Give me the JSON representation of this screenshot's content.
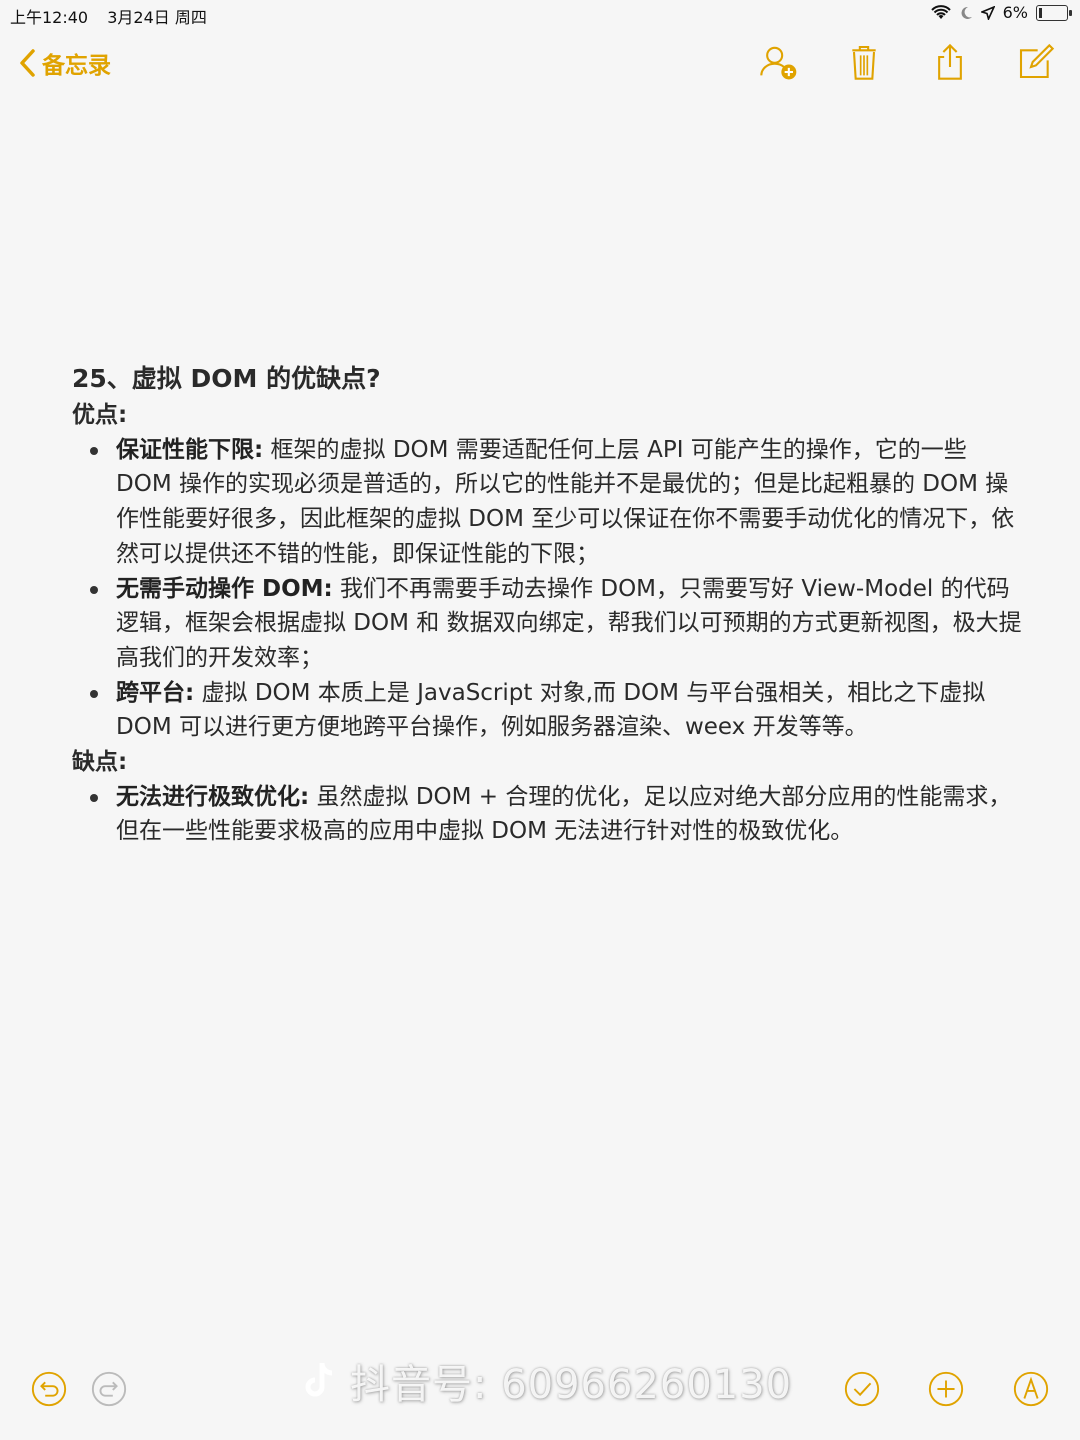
{
  "status_bar": {
    "time": "上午12:40",
    "date": "3月24日 周四",
    "battery": "6%"
  },
  "nav": {
    "back_label": "备忘录",
    "accent_color": "#e0a300"
  },
  "note": {
    "title": "25、虚拟 DOM 的优缺点?",
    "pros_label": "优点:",
    "pros": [
      {
        "term": "保证性能下限:",
        "text": " 框架的虚拟 DOM 需要适配任何上层 API 可能产生的操作，它的一些 DOM 操作的实现必须是普适的，所以它的性能并不是最优的；但是比起粗暴的 DOM 操作性能要好很多，因此框架的虚拟 DOM 至少可以保证在你不需要手动优化的情况下，依然可以提供还不错的性能，即保证性能的下限；"
      },
      {
        "term": "无需手动操作 DOM:",
        "text": " 我们不再需要手动去操作 DOM，只需要写好 View-Model 的代码逻辑，框架会根据虚拟 DOM 和 数据双向绑定，帮我们以可预期的方式更新视图，极大提高我们的开发效率；"
      },
      {
        "term": "跨平台:",
        "text": " 虚拟 DOM 本质上是 JavaScript 对象,而 DOM 与平台强相关，相比之下虚拟 DOM 可以进行更方便地跨平台操作，例如服务器渲染、weex 开发等等。"
      }
    ],
    "cons_label": "缺点:",
    "cons": [
      {
        "term": "无法进行极致优化:",
        "text": " 虽然虚拟 DOM + 合理的优化，足以应对绝大部分应用的性能需求，但在一些性能要求极高的应用中虚拟 DOM 无法进行针对性的极致优化。"
      }
    ]
  },
  "watermark": {
    "text": "抖音号: 60966260130"
  },
  "icons": {
    "nav": [
      "add-person-icon",
      "trash-icon",
      "share-icon",
      "compose-icon"
    ],
    "bottom": [
      "undo-icon",
      "redo-icon",
      "checklist-icon",
      "add-icon",
      "markup-icon"
    ]
  }
}
